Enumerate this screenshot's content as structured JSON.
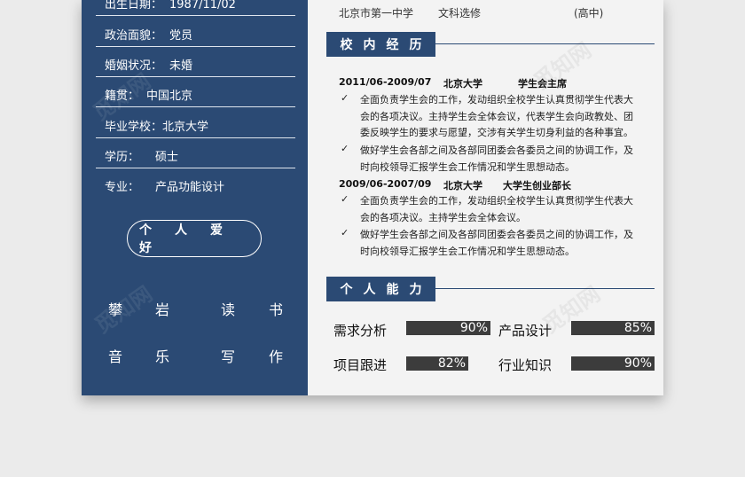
{
  "personal": [
    {
      "label": "出生日期：",
      "value": "1987/11/02"
    },
    {
      "label": "政治面貌：",
      "value": "党员"
    },
    {
      "label": "婚姻状况：",
      "value": "未婚"
    },
    {
      "label": "籍贯：",
      "value": "中国北京"
    },
    {
      "label": "毕业学校：",
      "value": "北京大学"
    },
    {
      "label": "学历：",
      "value": "硕士"
    },
    {
      "label": "专业：",
      "value": "产品功能设计"
    }
  ],
  "hobbies": {
    "title": [
      "个",
      "人",
      "爱",
      "好"
    ],
    "chars": [
      "攀",
      "岩",
      "读",
      "书",
      "音",
      "乐",
      "写",
      "作"
    ]
  },
  "education_row": {
    "school": "北京市第一中学",
    "major": "文科选修",
    "level": "(高中)"
  },
  "campus": {
    "title": [
      "校",
      "内",
      "经",
      "历"
    ],
    "items": [
      {
        "period": "2011/06-2009/07",
        "org": "北京大学",
        "role": "学生会主席",
        "bullets": [
          [
            "全面负责学生会的工作，发动组织全校学生认真贯彻学生代表大",
            "会的各项决议。主持学生会全体会议，代表学生会向政教处、团",
            "委反映学生的要求与愿望，交涉有关学生切身利益的各种事宜。"
          ],
          [
            "做好学生会各部之间及各部同团委会各委员之间的协调工作，及",
            "时向校领导汇报学生会工作情况和学生思想动态。"
          ]
        ]
      },
      {
        "period": "2009/06-2007/09",
        "org": "北京大学",
        "role": "大学生创业部长",
        "bullets": [
          [
            "全面负责学生会的工作，发动组织全校学生认真贯彻学生代表大",
            "会的各项决议。主持学生会全体会议。"
          ],
          [
            "做好学生会各部之间及各部同团委会各委员之间的协调工作，及",
            "时向校领导汇报学生会工作情况和学生思想动态。"
          ]
        ]
      }
    ],
    "tick": "✓"
  },
  "skills": {
    "title": [
      "个",
      "人",
      "能",
      "力"
    ],
    "items": [
      {
        "name": "需求分析",
        "percent": 90,
        "label": "90%"
      },
      {
        "name": "产品设计",
        "percent": 85,
        "label": "85%"
      },
      {
        "name": "项目跟进",
        "percent": 82,
        "label": "82%"
      },
      {
        "name": "行业知识",
        "percent": 90,
        "label": "90%"
      }
    ]
  },
  "watermark": "觅知网",
  "colors": {
    "accent": "#2b4a74",
    "bar": "#3c3c3c"
  }
}
